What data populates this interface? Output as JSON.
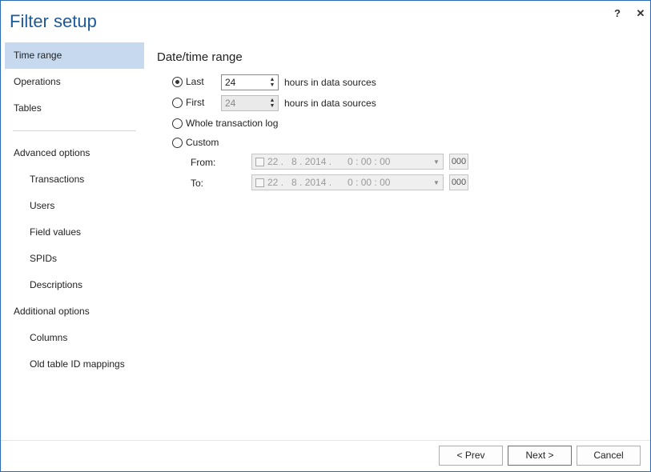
{
  "window": {
    "title": "Filter setup",
    "help_label": "?",
    "close_label": "✕"
  },
  "sidebar": {
    "items": [
      {
        "label": "Time range",
        "active": true,
        "sub": false
      },
      {
        "label": "Operations",
        "active": false,
        "sub": false
      },
      {
        "label": "Tables",
        "active": false,
        "sub": false
      }
    ],
    "advanced": [
      {
        "label": "Advanced options",
        "sub": false
      },
      {
        "label": "Transactions",
        "sub": true
      },
      {
        "label": "Users",
        "sub": true
      },
      {
        "label": "Field values",
        "sub": true
      },
      {
        "label": "SPIDs",
        "sub": true
      },
      {
        "label": "Descriptions",
        "sub": true
      },
      {
        "label": "Additional options",
        "sub": false
      },
      {
        "label": "Columns",
        "sub": true
      },
      {
        "label": "Old table ID mappings",
        "sub": true
      }
    ]
  },
  "content": {
    "section_title": "Date/time range",
    "last": {
      "label": "Last",
      "value": "24",
      "suffix": "hours in data sources",
      "checked": true
    },
    "first": {
      "label": "First",
      "value": "24",
      "suffix": "hours in data sources",
      "checked": false
    },
    "whole": {
      "label": "Whole transaction log",
      "checked": false
    },
    "custom": {
      "label": "Custom",
      "checked": false
    },
    "from": {
      "label": "From:",
      "value": "22 .   8 . 2014 .      0 : 00 : 00",
      "ms": "000"
    },
    "to": {
      "label": "To:",
      "value": "22 .   8 . 2014 .      0 : 00 : 00",
      "ms": "000"
    }
  },
  "footer": {
    "prev_label": "< Prev",
    "next_label": "Next >",
    "cancel_label": "Cancel"
  }
}
